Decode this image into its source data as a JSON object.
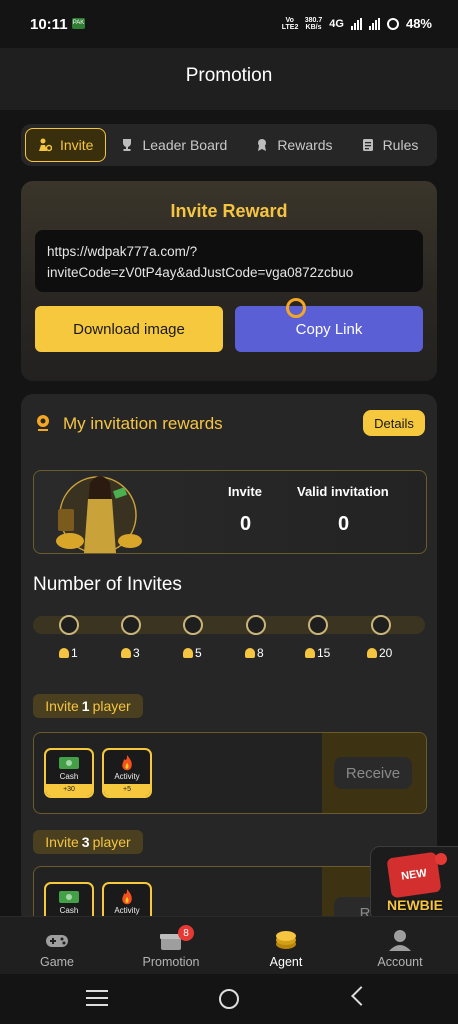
{
  "status_bar": {
    "time": "10:11",
    "app_icon_text": "PAK",
    "volte": "Vo LTE2",
    "speed_value": "380.7",
    "speed_unit": "KB/s",
    "network": "4G",
    "battery": "48%"
  },
  "header": {
    "title": "Promotion"
  },
  "tabs": [
    {
      "label": "Invite",
      "icon": "invite-icon",
      "active": true
    },
    {
      "label": "Leader Board",
      "icon": "trophy-icon",
      "active": false
    },
    {
      "label": "Rewards",
      "icon": "medal-icon",
      "active": false
    },
    {
      "label": "Rules",
      "icon": "document-icon",
      "active": false
    }
  ],
  "invite_reward": {
    "title": "Invite Reward",
    "link_line1": "https://wdpak777a.com/?",
    "link_line2": "inviteCode=zV0tP4ay&adJustCode=vga0872zcbuo",
    "download_label": "Download image",
    "copy_label": "Copy Link"
  },
  "my_rewards": {
    "title": "My invitation rewards",
    "details_label": "Details",
    "invite_label": "Invite",
    "invite_value": "0",
    "valid_label": "Valid invitation",
    "valid_value": "0"
  },
  "invites": {
    "heading": "Number of Invites",
    "milestones": [
      "1",
      "3",
      "5",
      "8",
      "15",
      "20"
    ],
    "progress": 0
  },
  "tiers": [
    {
      "prefix": "Invite",
      "count": "1",
      "suffix": "player",
      "rewards": [
        {
          "label": "Cash",
          "amount": "+30",
          "icon": "cash-icon"
        },
        {
          "label": "Activity",
          "amount": "+5",
          "icon": "fire-icon"
        }
      ],
      "button": "Receive"
    },
    {
      "prefix": "Invite",
      "count": "3",
      "suffix": "player",
      "rewards": [
        {
          "label": "Cash",
          "amount": "",
          "icon": "cash-icon"
        },
        {
          "label": "Activity",
          "amount": "",
          "icon": "fire-icon"
        }
      ],
      "button": "Rec"
    }
  ],
  "newbie": {
    "badge": "NEW",
    "label": "NEWBIE"
  },
  "bottom_nav": [
    {
      "label": "Game",
      "icon": "gamepad-icon",
      "active": false
    },
    {
      "label": "Promotion",
      "icon": "gift-icon",
      "badge": "8",
      "active": false
    },
    {
      "label": "Agent",
      "icon": "coin-icon",
      "active": true
    },
    {
      "label": "Account",
      "icon": "user-icon",
      "active": false
    }
  ],
  "colors": {
    "accent": "#f5c542",
    "copy_button": "#5b5fd6",
    "background": "#141414",
    "card": "#262626"
  }
}
